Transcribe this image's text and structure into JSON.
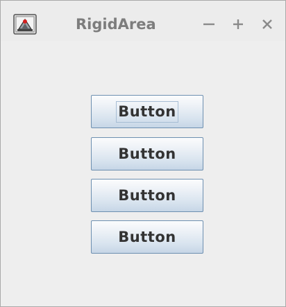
{
  "window": {
    "title": "RigidArea",
    "controls": {
      "minimize_icon": "minus-icon",
      "maximize_icon": "plus-icon",
      "close_icon": "x-icon"
    }
  },
  "buttons": [
    {
      "label": "Button",
      "focused": true
    },
    {
      "label": "Button",
      "focused": false
    },
    {
      "label": "Button",
      "focused": false
    },
    {
      "label": "Button",
      "focused": false
    }
  ],
  "colors": {
    "title_text": "#7d7d7d",
    "button_border": "#6d8fb0",
    "button_text": "#333333",
    "background": "#eeeeee"
  }
}
